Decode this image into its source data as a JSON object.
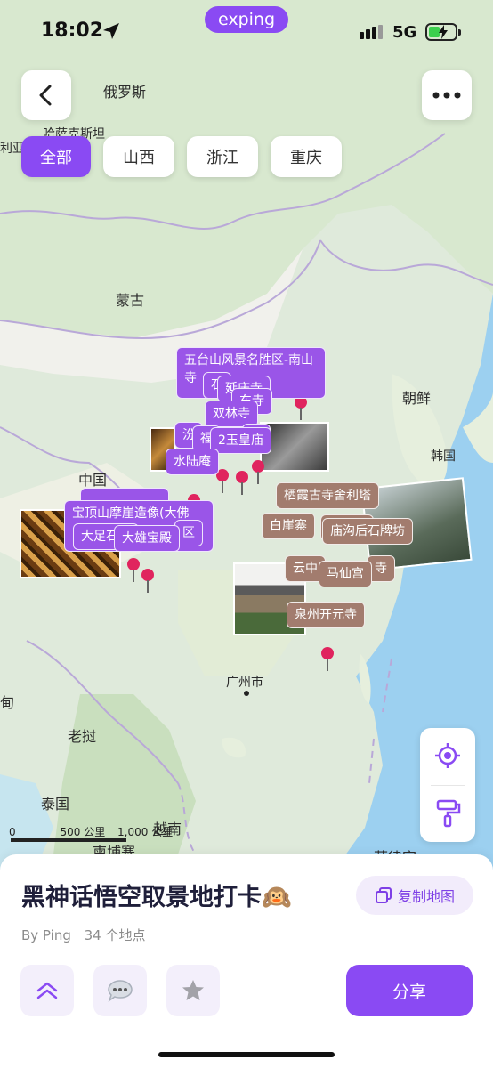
{
  "status_bar": {
    "time": "18:02",
    "brand": "exping",
    "network": "5G"
  },
  "filters": [
    "全部",
    "山西",
    "浙江",
    "重庆"
  ],
  "active_filter": "全部",
  "map_labels": {
    "russia": "俄罗斯",
    "kazakh": "哈萨克斯坦",
    "mongolia": "蒙古",
    "china": "中国",
    "north_korea": "朝鲜",
    "south_korea": "韩国",
    "guangzhou": "广州市",
    "laos": "老挝",
    "thailand": "泰国",
    "vietnam": "越南",
    "cambodia": "柬埔寨",
    "philippines": "菲律宾",
    "left_edge_1": "利亚",
    "left_edge_2": "甸"
  },
  "markers": {
    "wutai": "五台山风景名胜区-南山寺",
    "shuanglin": "双林寺",
    "yuhuang": "2玉皇庙",
    "shuilu": "水陆庵",
    "baoding": "宝顶山摩崖造像(大佛",
    "dazu": "大足石刻",
    "daxiong": "大雄宝殿",
    "qixia": "栖霞古寺舍利塔",
    "baiya": "白崖寨",
    "miaogou": "庙沟后石牌坊",
    "yunzhong": "云中",
    "mashan": "马仙宫",
    "quanzhou": "泉州开元寺",
    "frag_si": "寺",
    "frag_shi": "石",
    "frag_yan": "延庆寺",
    "frag_dong": "东寺",
    "frag_fu": "福",
    "frag_fen": "汾",
    "frag_miao": "庙",
    "frag_qu": "区",
    "frag_si2": "寺"
  },
  "scale": {
    "label_0": "0",
    "label_500": "500 公里",
    "label_1000": "1,000 公里"
  },
  "sheet": {
    "title": "黑神话悟空取景地打卡🙉",
    "copy_label": "复制地图",
    "author": "By Ping",
    "count": "34 个地点",
    "share_label": "分享"
  },
  "colors": {
    "accent": "#8a4af3",
    "marker_purple": "#9a55e8",
    "marker_brown": "#a27c6e",
    "pin": "#e0245e"
  }
}
